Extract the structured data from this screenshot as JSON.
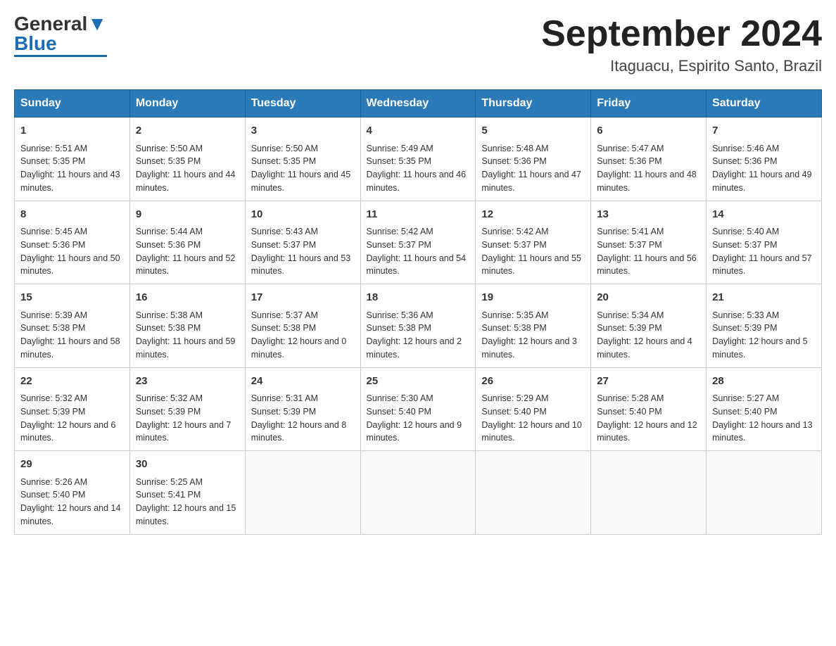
{
  "header": {
    "logo": {
      "text_general": "General",
      "text_blue": "Blue"
    },
    "title": "September 2024",
    "location": "Itaguacu, Espirito Santo, Brazil"
  },
  "days_of_week": [
    "Sunday",
    "Monday",
    "Tuesday",
    "Wednesday",
    "Thursday",
    "Friday",
    "Saturday"
  ],
  "weeks": [
    [
      {
        "day": "1",
        "sunrise": "5:51 AM",
        "sunset": "5:35 PM",
        "daylight": "11 hours and 43 minutes."
      },
      {
        "day": "2",
        "sunrise": "5:50 AM",
        "sunset": "5:35 PM",
        "daylight": "11 hours and 44 minutes."
      },
      {
        "day": "3",
        "sunrise": "5:50 AM",
        "sunset": "5:35 PM",
        "daylight": "11 hours and 45 minutes."
      },
      {
        "day": "4",
        "sunrise": "5:49 AM",
        "sunset": "5:35 PM",
        "daylight": "11 hours and 46 minutes."
      },
      {
        "day": "5",
        "sunrise": "5:48 AM",
        "sunset": "5:36 PM",
        "daylight": "11 hours and 47 minutes."
      },
      {
        "day": "6",
        "sunrise": "5:47 AM",
        "sunset": "5:36 PM",
        "daylight": "11 hours and 48 minutes."
      },
      {
        "day": "7",
        "sunrise": "5:46 AM",
        "sunset": "5:36 PM",
        "daylight": "11 hours and 49 minutes."
      }
    ],
    [
      {
        "day": "8",
        "sunrise": "5:45 AM",
        "sunset": "5:36 PM",
        "daylight": "11 hours and 50 minutes."
      },
      {
        "day": "9",
        "sunrise": "5:44 AM",
        "sunset": "5:36 PM",
        "daylight": "11 hours and 52 minutes."
      },
      {
        "day": "10",
        "sunrise": "5:43 AM",
        "sunset": "5:37 PM",
        "daylight": "11 hours and 53 minutes."
      },
      {
        "day": "11",
        "sunrise": "5:42 AM",
        "sunset": "5:37 PM",
        "daylight": "11 hours and 54 minutes."
      },
      {
        "day": "12",
        "sunrise": "5:42 AM",
        "sunset": "5:37 PM",
        "daylight": "11 hours and 55 minutes."
      },
      {
        "day": "13",
        "sunrise": "5:41 AM",
        "sunset": "5:37 PM",
        "daylight": "11 hours and 56 minutes."
      },
      {
        "day": "14",
        "sunrise": "5:40 AM",
        "sunset": "5:37 PM",
        "daylight": "11 hours and 57 minutes."
      }
    ],
    [
      {
        "day": "15",
        "sunrise": "5:39 AM",
        "sunset": "5:38 PM",
        "daylight": "11 hours and 58 minutes."
      },
      {
        "day": "16",
        "sunrise": "5:38 AM",
        "sunset": "5:38 PM",
        "daylight": "11 hours and 59 minutes."
      },
      {
        "day": "17",
        "sunrise": "5:37 AM",
        "sunset": "5:38 PM",
        "daylight": "12 hours and 0 minutes."
      },
      {
        "day": "18",
        "sunrise": "5:36 AM",
        "sunset": "5:38 PM",
        "daylight": "12 hours and 2 minutes."
      },
      {
        "day": "19",
        "sunrise": "5:35 AM",
        "sunset": "5:38 PM",
        "daylight": "12 hours and 3 minutes."
      },
      {
        "day": "20",
        "sunrise": "5:34 AM",
        "sunset": "5:39 PM",
        "daylight": "12 hours and 4 minutes."
      },
      {
        "day": "21",
        "sunrise": "5:33 AM",
        "sunset": "5:39 PM",
        "daylight": "12 hours and 5 minutes."
      }
    ],
    [
      {
        "day": "22",
        "sunrise": "5:32 AM",
        "sunset": "5:39 PM",
        "daylight": "12 hours and 6 minutes."
      },
      {
        "day": "23",
        "sunrise": "5:32 AM",
        "sunset": "5:39 PM",
        "daylight": "12 hours and 7 minutes."
      },
      {
        "day": "24",
        "sunrise": "5:31 AM",
        "sunset": "5:39 PM",
        "daylight": "12 hours and 8 minutes."
      },
      {
        "day": "25",
        "sunrise": "5:30 AM",
        "sunset": "5:40 PM",
        "daylight": "12 hours and 9 minutes."
      },
      {
        "day": "26",
        "sunrise": "5:29 AM",
        "sunset": "5:40 PM",
        "daylight": "12 hours and 10 minutes."
      },
      {
        "day": "27",
        "sunrise": "5:28 AM",
        "sunset": "5:40 PM",
        "daylight": "12 hours and 12 minutes."
      },
      {
        "day": "28",
        "sunrise": "5:27 AM",
        "sunset": "5:40 PM",
        "daylight": "12 hours and 13 minutes."
      }
    ],
    [
      {
        "day": "29",
        "sunrise": "5:26 AM",
        "sunset": "5:40 PM",
        "daylight": "12 hours and 14 minutes."
      },
      {
        "day": "30",
        "sunrise": "5:25 AM",
        "sunset": "5:41 PM",
        "daylight": "12 hours and 15 minutes."
      },
      null,
      null,
      null,
      null,
      null
    ]
  ]
}
